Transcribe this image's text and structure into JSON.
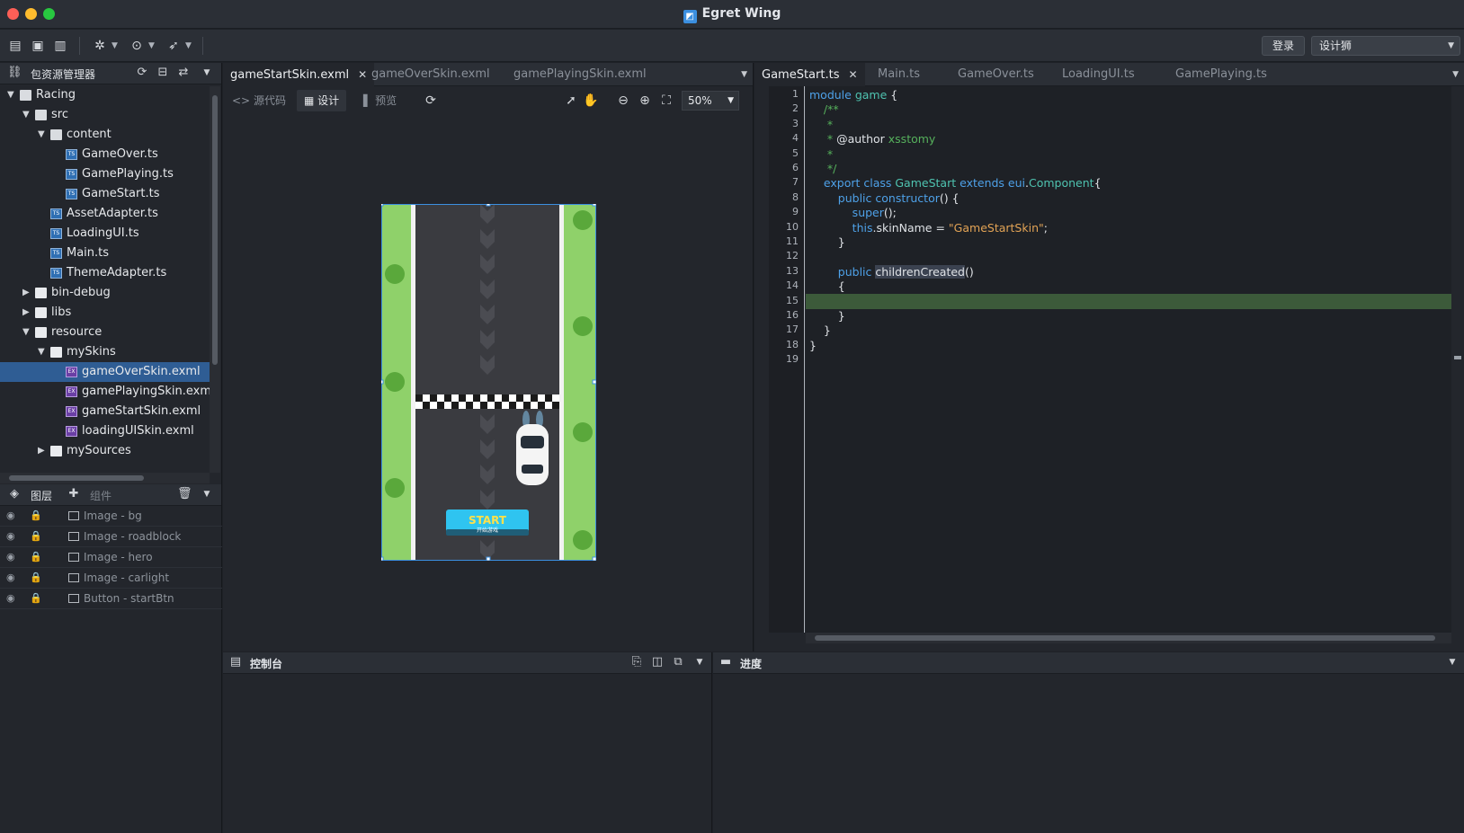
{
  "window": {
    "title": "Egret Wing",
    "logo_glyph": "◩"
  },
  "toolbar": {
    "login_label": "登录",
    "profile_value": "设计狮",
    "icons": [
      "open-folder-icon",
      "save-icon",
      "save-all-icon",
      "debug-icon",
      "run-icon",
      "publish-icon"
    ]
  },
  "resource_panel": {
    "title": "包资源管理器",
    "tree": [
      {
        "label": "Racing",
        "depth": 0,
        "kind": "project",
        "expanded": true
      },
      {
        "label": "src",
        "depth": 1,
        "kind": "pkg",
        "expanded": true
      },
      {
        "label": "content",
        "depth": 2,
        "kind": "pkg",
        "expanded": true
      },
      {
        "label": "GameOver.ts",
        "depth": 3,
        "kind": "ts"
      },
      {
        "label": "GamePlaying.ts",
        "depth": 3,
        "kind": "ts"
      },
      {
        "label": "GameStart.ts",
        "depth": 3,
        "kind": "ts"
      },
      {
        "label": "AssetAdapter.ts",
        "depth": 2,
        "kind": "ts"
      },
      {
        "label": "LoadingUI.ts",
        "depth": 2,
        "kind": "ts"
      },
      {
        "label": "Main.ts",
        "depth": 2,
        "kind": "ts"
      },
      {
        "label": "ThemeAdapter.ts",
        "depth": 2,
        "kind": "ts"
      },
      {
        "label": "bin-debug",
        "depth": 1,
        "kind": "folder",
        "expanded": false
      },
      {
        "label": "libs",
        "depth": 1,
        "kind": "folder",
        "expanded": false
      },
      {
        "label": "resource",
        "depth": 1,
        "kind": "folder",
        "expanded": true
      },
      {
        "label": "mySkins",
        "depth": 2,
        "kind": "folder",
        "expanded": true
      },
      {
        "label": "gameOverSkin.exml",
        "depth": 3,
        "kind": "exml",
        "selected": true
      },
      {
        "label": "gamePlayingSkin.exml",
        "depth": 3,
        "kind": "exml"
      },
      {
        "label": "gameStartSkin.exml",
        "depth": 3,
        "kind": "exml"
      },
      {
        "label": "loadingUISkin.exml",
        "depth": 3,
        "kind": "exml"
      },
      {
        "label": "mySources",
        "depth": 2,
        "kind": "folder",
        "expanded": false
      }
    ]
  },
  "layers_panel": {
    "tab_layers": "图层",
    "tab_components": "组件",
    "items": [
      {
        "label": "Image - bg",
        "icon": "image-icon"
      },
      {
        "label": "Image - roadblock",
        "icon": "image-icon"
      },
      {
        "label": "Image - hero",
        "icon": "image-icon"
      },
      {
        "label": "Image - carlight",
        "icon": "image-icon"
      },
      {
        "label": "Button - startBtn",
        "icon": "button-icon"
      }
    ]
  },
  "design_editor": {
    "tabs": [
      {
        "label": "gameStartSkin.exml",
        "active": true
      },
      {
        "label": "gameOverSkin.exml",
        "active": false
      },
      {
        "label": "gamePlayingSkin.exml",
        "active": false
      }
    ],
    "mode_source": "源代码",
    "mode_design": "设计",
    "mode_preview": "预览",
    "zoom": "50%",
    "start_button_label": "START",
    "start_button_sub": "开始游戏"
  },
  "code_editor": {
    "tabs": [
      {
        "label": "GameStart.ts",
        "active": true
      },
      {
        "label": "Main.ts",
        "active": false
      },
      {
        "label": "GameOver.ts",
        "active": false
      },
      {
        "label": "LoadingUI.ts",
        "active": false
      },
      {
        "label": "GamePlaying.ts",
        "active": false
      }
    ],
    "line_numbers": [
      "1",
      "2",
      "3",
      "4",
      "5",
      "6",
      "7",
      "8",
      "9",
      "10",
      "11",
      "12",
      "13",
      "14",
      "15",
      "16",
      "17",
      "18",
      "19"
    ],
    "active_line": 15,
    "lines": [
      [
        {
          "t": "module ",
          "c": "kw"
        },
        {
          "t": "game ",
          "c": "ty"
        },
        {
          "t": "{",
          "c": "pl"
        }
      ],
      [
        {
          "t": "    /**",
          "c": "cm"
        }
      ],
      [
        {
          "t": "     *",
          "c": "cm"
        }
      ],
      [
        {
          "t": "     * ",
          "c": "cm"
        },
        {
          "t": "@author ",
          "c": "pl"
        },
        {
          "t": "xsstomy",
          "c": "cm"
        }
      ],
      [
        {
          "t": "     *",
          "c": "cm"
        }
      ],
      [
        {
          "t": "     */",
          "c": "cm"
        }
      ],
      [
        {
          "t": "    export ",
          "c": "kw"
        },
        {
          "t": "class ",
          "c": "kw"
        },
        {
          "t": "GameStart ",
          "c": "ty"
        },
        {
          "t": "extends ",
          "c": "kw"
        },
        {
          "t": "eui",
          "c": "kw"
        },
        {
          "t": ".",
          "c": "pl"
        },
        {
          "t": "Component",
          "c": "ty"
        },
        {
          "t": "{",
          "c": "pl"
        }
      ],
      [
        {
          "t": "        public ",
          "c": "kw"
        },
        {
          "t": "constructor",
          "c": "kw"
        },
        {
          "t": "() {",
          "c": "pl"
        }
      ],
      [
        {
          "t": "            super",
          "c": "kw"
        },
        {
          "t": "();",
          "c": "pl"
        }
      ],
      [
        {
          "t": "            this",
          "c": "kw"
        },
        {
          "t": ".skinName = ",
          "c": "pl"
        },
        {
          "t": "\"GameStartSkin\"",
          "c": "st"
        },
        {
          "t": ";",
          "c": "pl"
        }
      ],
      [
        {
          "t": "        }",
          "c": "pl"
        }
      ],
      [
        {
          "t": "",
          "c": "pl"
        }
      ],
      [
        {
          "t": "        public ",
          "c": "kw"
        },
        {
          "t": "childrenCreated",
          "c": "pl hl-word"
        },
        {
          "t": "()",
          "c": "pl"
        }
      ],
      [
        {
          "t": "        {",
          "c": "pl"
        }
      ],
      [
        {
          "t": "",
          "c": "pl"
        }
      ],
      [
        {
          "t": "        }",
          "c": "pl"
        }
      ],
      [
        {
          "t": "    }",
          "c": "pl"
        }
      ],
      [
        {
          "t": "}",
          "c": "pl"
        }
      ],
      [
        {
          "t": "",
          "c": "pl"
        }
      ]
    ]
  },
  "console_panel": {
    "title": "控制台"
  },
  "progress_panel": {
    "title": "进度"
  }
}
